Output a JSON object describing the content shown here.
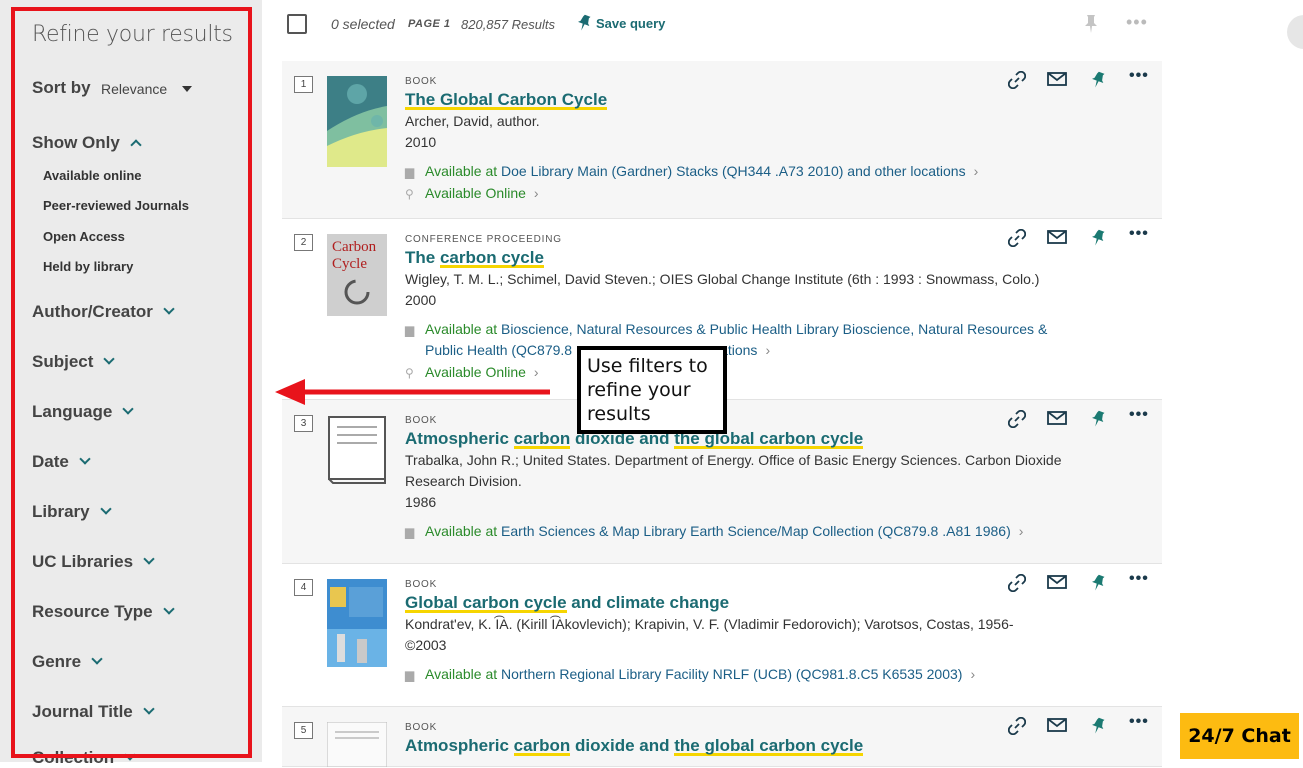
{
  "sidebar": {
    "title": "Refine your results",
    "sort_label": "Sort by",
    "sort_value": "Relevance",
    "show_only": {
      "label": "Show Only",
      "items": [
        "Available online",
        "Peer-reviewed Journals",
        "Open Access",
        "Held by library"
      ]
    },
    "facets": [
      "Author/Creator",
      "Subject",
      "Language",
      "Date",
      "Library",
      "UC Libraries",
      "Resource Type",
      "Genre",
      "Journal Title",
      "Collection"
    ]
  },
  "topbar": {
    "selected": "0 selected",
    "page": "PAGE 1",
    "results": "820,857 Results",
    "save_query": "Save query"
  },
  "results": [
    {
      "number": "1",
      "type": "BOOK",
      "title_segments": [
        {
          "text": "The Global Carbon Cycle",
          "hl": true
        }
      ],
      "authors": "Archer, David, author.",
      "year": "2010",
      "availability": [
        {
          "prefix": "Available at",
          "location": "Doe Library  Main (Gardner) Stacks (QH344 .A73 2010) and other locations"
        },
        {
          "prefix": "Available Online",
          "location": ""
        }
      ]
    },
    {
      "number": "2",
      "type": "CONFERENCE PROCEEDING",
      "title_segments": [
        {
          "text": "The ",
          "hl": false
        },
        {
          "text": "carbon cycle",
          "hl": true
        }
      ],
      "authors": "Wigley, T. M. L.; Schimel, David Steven.; OIES Global Change Institute (6th : 1993 : Snowmass, Colo.)",
      "year": "2000",
      "availability": [
        {
          "prefix": "Available at",
          "location": "Bioscience, Natural Resources & Public Health Library  Bioscience, Natural Resources &",
          "location2": "Public Health (QC879.8",
          "location2_tail": "ations"
        },
        {
          "prefix": "Available Online",
          "location": ""
        }
      ]
    },
    {
      "number": "3",
      "type": "BOOK",
      "title_segments": [
        {
          "text": "Atmospheric ",
          "hl": false
        },
        {
          "text": "carbon",
          "hl": true
        },
        {
          "text": " dioxide and ",
          "hl": false
        },
        {
          "text": "the global carbon cycle",
          "hl": true
        }
      ],
      "authors_line1": "Trabalka, John R.; United States. Department of Energy. Office of Basic Energy Sciences. Carbon Dioxide",
      "authors_line2": "Research Division.",
      "year": "1986",
      "availability": [
        {
          "prefix": "Available at",
          "location": "Earth Sciences & Map Library  Earth Science/Map Collection (QC879.8 .A81 1986)"
        }
      ]
    },
    {
      "number": "4",
      "type": "BOOK",
      "title_segments": [
        {
          "text": "Global carbon cycle",
          "hl": true
        },
        {
          "text": " and climate change",
          "hl": false
        }
      ],
      "authors": "Kondratʹev, K. I͡A. (Kirill I͡Akovlevich); Krapivin, V. F. (Vladimir Fedorovich); Varotsos, Costas, 1956-",
      "year": "©2003",
      "availability": [
        {
          "prefix": "Available at",
          "location": "Northern Regional Library Facility  NRLF (UCB) (QC981.8.C5 K6535 2003)"
        }
      ]
    },
    {
      "number": "5",
      "type": "BOOK",
      "title_segments": [
        {
          "text": "Atmospheric ",
          "hl": false
        },
        {
          "text": "carbon",
          "hl": true
        },
        {
          "text": " dioxide and ",
          "hl": false
        },
        {
          "text": "the global carbon cycle",
          "hl": true
        }
      ]
    }
  ],
  "callout": {
    "text": "Use filters to refine your results"
  },
  "chat": {
    "label": "24/7 Chat"
  },
  "colors": {
    "accent": "#1b6b72",
    "highlight": "#f6d500",
    "available": "#2a8a2a",
    "annotation_red": "#e8131b",
    "chat": "#fdbb11"
  }
}
